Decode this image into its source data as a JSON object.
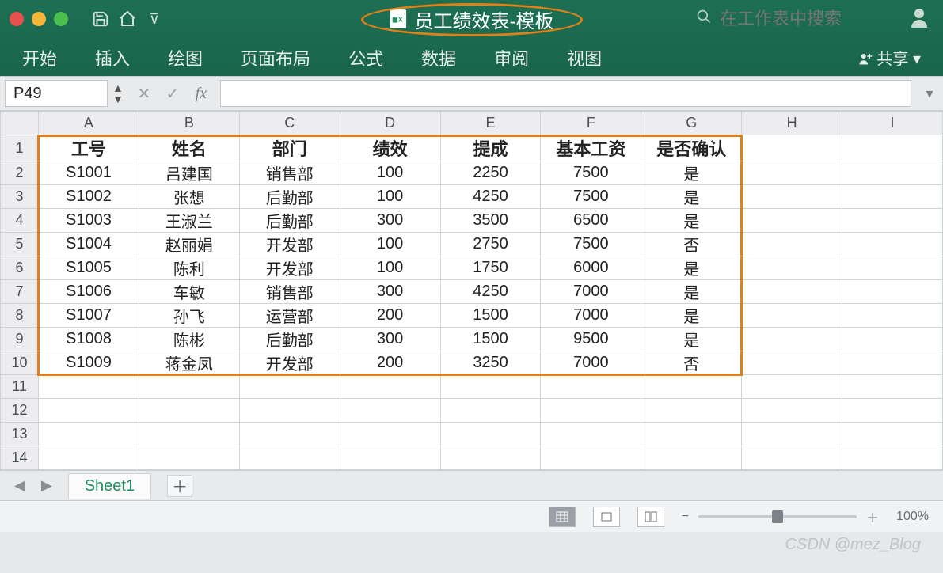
{
  "titlebar": {
    "doc_title": "员工绩效表-模板",
    "search_placeholder": "在工作表中搜索",
    "share_label": "共享"
  },
  "ribbon": {
    "tabs": [
      "开始",
      "插入",
      "绘图",
      "页面布局",
      "公式",
      "数据",
      "审阅",
      "视图"
    ]
  },
  "formula_bar": {
    "namebox_value": "P49",
    "fx_label": "fx"
  },
  "sheet": {
    "columns": [
      "A",
      "B",
      "C",
      "D",
      "E",
      "F",
      "G",
      "H",
      "I"
    ],
    "row_count": 14,
    "headers": [
      "工号",
      "姓名",
      "部门",
      "绩效",
      "提成",
      "基本工资",
      "是否确认"
    ],
    "rows": [
      [
        "S1001",
        "吕建国",
        "销售部",
        "100",
        "2250",
        "7500",
        "是"
      ],
      [
        "S1002",
        "张想",
        "后勤部",
        "100",
        "4250",
        "7500",
        "是"
      ],
      [
        "S1003",
        "王淑兰",
        "后勤部",
        "300",
        "3500",
        "6500",
        "是"
      ],
      [
        "S1004",
        "赵丽娟",
        "开发部",
        "100",
        "2750",
        "7500",
        "否"
      ],
      [
        "S1005",
        "陈利",
        "开发部",
        "100",
        "1750",
        "6000",
        "是"
      ],
      [
        "S1006",
        "车敏",
        "销售部",
        "300",
        "4250",
        "7000",
        "是"
      ],
      [
        "S1007",
        "孙飞",
        "运营部",
        "200",
        "1500",
        "7000",
        "是"
      ],
      [
        "S1008",
        "陈彬",
        "后勤部",
        "300",
        "1500",
        "9500",
        "是"
      ],
      [
        "S1009",
        "蒋金凤",
        "开发部",
        "200",
        "3250",
        "7000",
        "否"
      ]
    ]
  },
  "sheet_tabs": {
    "active": "Sheet1"
  },
  "statusbar": {
    "zoom": "100%"
  },
  "watermark": "CSDN @mez_Blog"
}
